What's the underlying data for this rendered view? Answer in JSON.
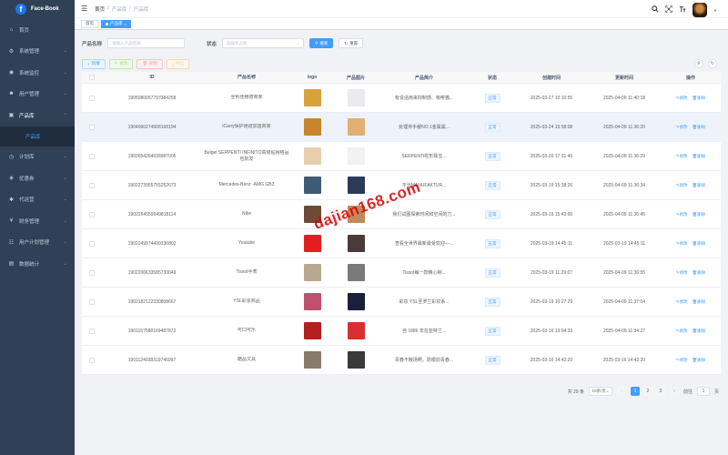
{
  "brand": {
    "name": "Face-Book",
    "logo_letter": "f"
  },
  "sidebar": {
    "items": [
      {
        "label": "首页",
        "icon": "home-icon",
        "glyph": "⌂",
        "has_children": false
      },
      {
        "label": "系统管理",
        "icon": "gear-icon",
        "glyph": "⚙",
        "has_children": true
      },
      {
        "label": "系统监控",
        "icon": "monitor-icon",
        "glyph": "◉",
        "has_children": true
      },
      {
        "label": "用户管理",
        "icon": "user-icon",
        "glyph": "☻",
        "has_children": true
      },
      {
        "label": "产品库",
        "icon": "box-icon",
        "glyph": "▣",
        "has_children": true,
        "open": true,
        "children": [
          {
            "label": "产品库"
          }
        ]
      },
      {
        "label": "计划库",
        "icon": "calendar-icon",
        "glyph": "◷",
        "has_children": true
      },
      {
        "label": "优惠券",
        "icon": "coupon-icon",
        "glyph": "◈",
        "has_children": true
      },
      {
        "label": "代运营",
        "icon": "cog-icon",
        "glyph": "✱",
        "has_children": true
      },
      {
        "label": "财务管理",
        "icon": "finance-icon",
        "glyph": "¥",
        "has_children": true
      },
      {
        "label": "用户计划管理",
        "icon": "plan-icon",
        "glyph": "☷",
        "has_children": true
      },
      {
        "label": "数据统计",
        "icon": "chart-icon",
        "glyph": "▤",
        "has_children": true
      }
    ]
  },
  "header": {
    "breadcrumb": [
      "首页",
      "/",
      "产品库",
      "/",
      "产品库"
    ]
  },
  "tags": {
    "home": "首页",
    "active": "产品库"
  },
  "search": {
    "name_label": "产品名称",
    "name_placeholder": "请输入产品名称",
    "status_label": "状态",
    "status_placeholder": "选择状态类",
    "search_btn": "搜索",
    "reset_btn": "重置"
  },
  "toolbar": {
    "add": "新增",
    "edit": "修改",
    "delete": "删除",
    "export": "导出"
  },
  "table": {
    "headers": [
      "ID",
      "产品名称",
      "logo",
      "产品图片",
      "产品简介",
      "状态",
      "创建时间",
      "更新时间",
      "操作"
    ],
    "edit_label": "修改",
    "delete_label": "删除",
    "rows": [
      {
        "id": "1905080057797384258",
        "name": "全利佳鲍德商家",
        "desc": "有说话用来抑制感、咖啡猫...",
        "status": "正常",
        "created": "2025-03-27 10:10:55",
        "updated": "2025-04-09 11:40:18",
        "logo_color": "#d8a23b",
        "pic_color": "#e8eaf0"
      },
      {
        "id": "1904060274908168194",
        "name": "iCarry保护通道加盟商家",
        "desc": "处理伴手缓NO.1金属属...",
        "status": "正常",
        "created": "2025-03-24 15:58:08",
        "updated": "2025-04-09 11:36:20",
        "logo_color": "#c9852c",
        "pic_color": "#e0b070"
      },
      {
        "id": "1902654264938987005",
        "name": "Belgei SERPENTI INFINITO高级贴网络品包批发",
        "desc": "SERPENTI蛇形珠宝...",
        "status": "正常",
        "created": "2025-03-20 17:31:40",
        "updated": "2025-04-09 11:36:29",
        "logo_color": "#e7cfae",
        "pic_color": "#f2f2f5"
      },
      {
        "id": "1902273955755252673",
        "name": "Mercedes-Benz -AMG GB3",
        "desc": "平治MANUFAKTUR...",
        "status": "正常",
        "created": "2025-03-19 15:38:26",
        "updated": "2025-04-09 11:36:34",
        "logo_color": "#3f5a75",
        "pic_color": "#2a3a58"
      },
      {
        "id": "1902264559049818114",
        "name": "Nike",
        "desc": "我们试图探索时间和空间的力...",
        "status": "正常",
        "created": "2025-03-19 15:43:00",
        "updated": "2025-04-09 11:36:45",
        "logo_color": "#6f4a36",
        "pic_color": "#c08a5a"
      },
      {
        "id": "1902249974499336802",
        "name": "Youtube",
        "desc": "查看全世界最新最受欢迎—...",
        "status": "正常",
        "created": "2025-03-19 14:45:11",
        "updated": "2025-03-19 14:45:11",
        "logo_color": "#e02020",
        "pic_color": "#4a3a3a"
      },
      {
        "id": "1902206633585730049",
        "name": "Tissot手表",
        "desc": "Tissot每一款精心制...",
        "status": "正常",
        "created": "2025-03-19 11:29:07",
        "updated": "2025-04-09 11:36:55",
        "logo_color": "#b8a890",
        "pic_color": "#7a7a7a"
      },
      {
        "id": "1902182122330808667",
        "name": "YSL彩妆商品",
        "desc": "彩妆 YSL圣罗兰彩妆系...",
        "status": "正常",
        "created": "2025-03-19 10:27:29",
        "updated": "2025-04-09 11:37:04",
        "logo_color": "#c05070",
        "pic_color": "#1a1f3a"
      },
      {
        "id": "1901157588169487873",
        "name": "可口可乐",
        "desc": "自 1886 年在亚特兰...",
        "status": "正常",
        "created": "2025-03-16 13:04:33",
        "updated": "2025-04-09 11:34:27",
        "logo_color": "#b32020",
        "pic_color": "#d83030"
      },
      {
        "id": "1901124038319746097",
        "name": "酷品文具",
        "desc": "青春不散场啊，愿眼前青春...",
        "status": "正常",
        "created": "2025-03-16 14:42:20",
        "updated": "2025-03-16 14:42:20",
        "logo_color": "#8a7a6a",
        "pic_color": "#3a3a3a"
      }
    ]
  },
  "pagination": {
    "total": "共 29 条",
    "page_size": "10条/页",
    "pages": [
      "1",
      "2",
      "3"
    ],
    "current": "1",
    "goto_label": "前往",
    "goto_value": "1",
    "page_suffix": "页"
  },
  "watermark": "dajian168.com"
}
